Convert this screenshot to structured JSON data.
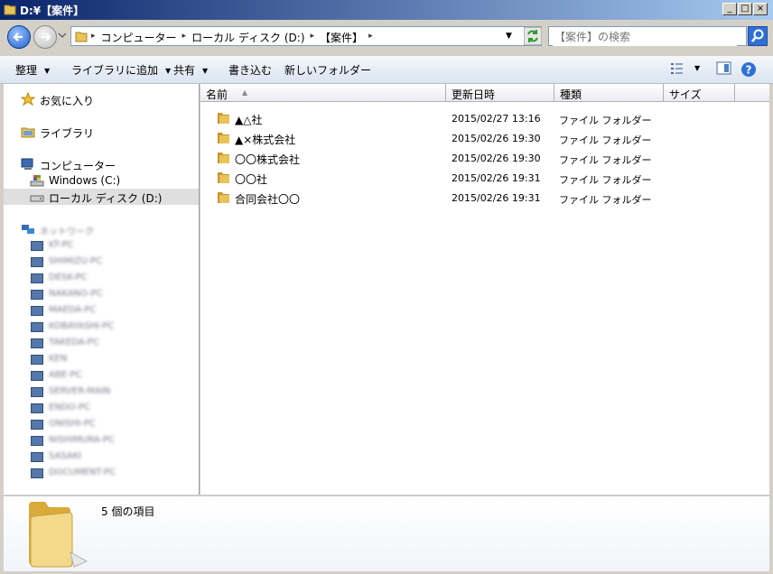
{
  "window": {
    "title": "D:¥【案件】"
  },
  "address": {
    "crumbs": [
      "コンピューター",
      "ローカル ディスク (D:)",
      "【案件】"
    ]
  },
  "search": {
    "placeholder": "【案件】の検索"
  },
  "toolbar": {
    "organize": "整理",
    "add_to_library": "ライブラリに追加",
    "share": "共有",
    "burn": "書き込む",
    "new_folder": "新しいフォルダー"
  },
  "nav": {
    "favorites": "お気に入り",
    "libraries": "ライブラリ",
    "computer": "コンピューター",
    "windows_drive": "Windows (C:)",
    "local_disk": "ローカル ディスク (D:)",
    "network": "ネットワーク",
    "network_items": [
      "KT-PC",
      "SHIMIZU-PC",
      "DESK-PC",
      "NAKANO-PC",
      "MAEDA-PC",
      "KOBAYASHI-PC",
      "TAKEDA-PC",
      "KEN",
      "ABE-PC",
      "SERVER-MAIN",
      "ENDO-PC",
      "ONISHI-PC",
      "NISHIMURA-PC",
      "SASAKI",
      "DOCUMENT-PC"
    ]
  },
  "columns": {
    "name": "名前",
    "modified": "更新日時",
    "type": "種類",
    "size": "サイズ"
  },
  "files": [
    {
      "name": "▲△社",
      "modified": "2015/02/27 13:16",
      "type": "ファイル フォルダー"
    },
    {
      "name": "▲×株式会社",
      "modified": "2015/02/26 19:30",
      "type": "ファイル フォルダー"
    },
    {
      "name": "〇〇株式会社",
      "modified": "2015/02/26 19:30",
      "type": "ファイル フォルダー"
    },
    {
      "name": "〇〇社",
      "modified": "2015/02/26 19:31",
      "type": "ファイル フォルダー"
    },
    {
      "name": "合同会社〇〇",
      "modified": "2015/02/26 19:31",
      "type": "ファイル フォルダー"
    }
  ],
  "details": {
    "item_count": "5 個の項目"
  },
  "colors": {
    "folder": "#e8c35a",
    "accent": "#2f6fd6"
  }
}
